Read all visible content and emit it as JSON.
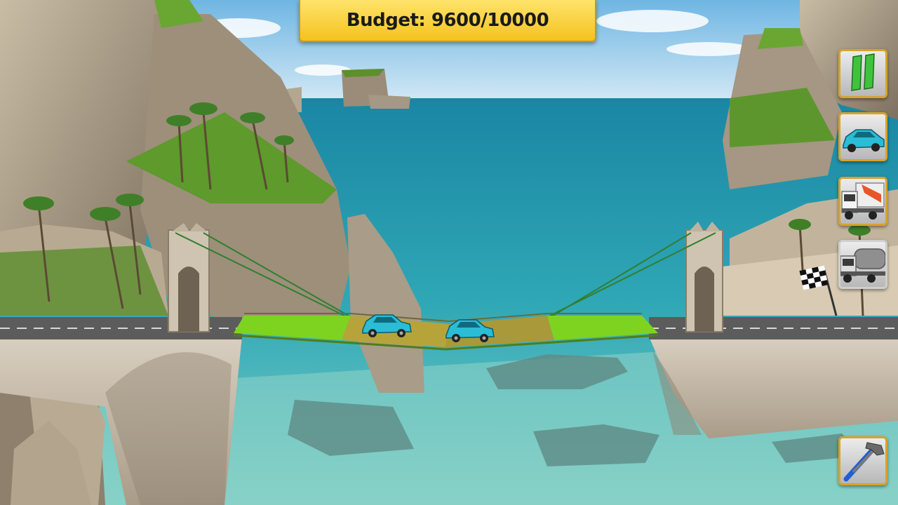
{
  "hud": {
    "budget_text": "Budget: 9600/10000"
  },
  "controls": {
    "pause_icon": "pause-icon",
    "car_icon": "car-icon",
    "truck_icon": "truck-icon",
    "tanker_icon": "tanker-truck-icon",
    "build_icon": "hammer-wrench-icon"
  },
  "colors": {
    "budget_banner": "#f4c21f",
    "button_border": "#d7a32a",
    "road_deck": "#7ed321",
    "sea": "#1e8fa6"
  }
}
